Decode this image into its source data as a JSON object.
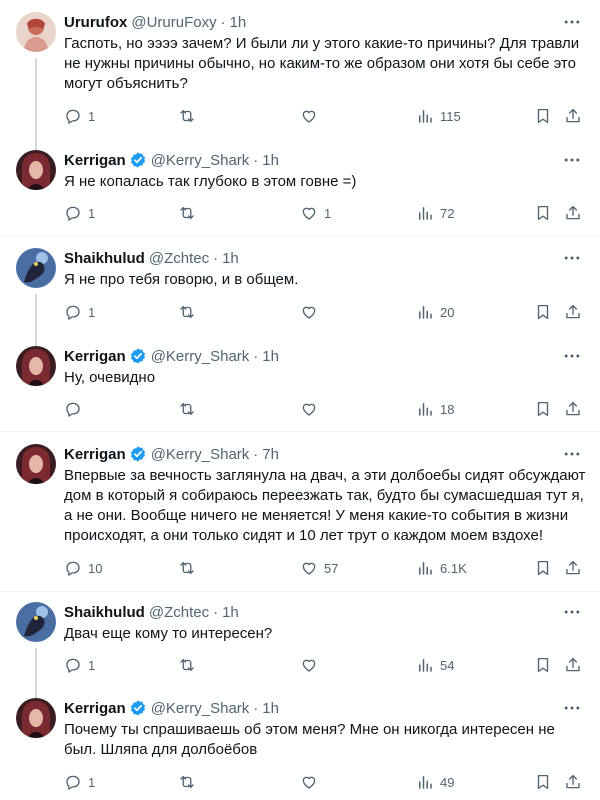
{
  "icons": {
    "reply": "reply-icon",
    "retweet": "retweet-icon",
    "like": "heart-icon",
    "views": "views-chart-icon",
    "bookmark": "bookmark-icon",
    "share": "share-icon",
    "more": "more-dots-icon",
    "verified": "verified-badge-icon"
  },
  "colors": {
    "accent": "#1d9bf0",
    "text": "#0f1419",
    "muted": "#536471",
    "line": "#cfd9de"
  },
  "tweets": [
    {
      "name": "Ururufox",
      "handle": "@UruruFoxy",
      "dot": "·",
      "time": "1h",
      "text": "Гаспоть, но ээээ зачем? И были ли у этого какие-то причины? Для травли не нужны причины обычно, но каким-то же образом они хотя бы себе это могут объяснить?",
      "replies": "1",
      "retweets": "",
      "likes": "",
      "views": "115"
    },
    {
      "name": "Kerrigan",
      "handle": "@Kerry_Shark",
      "dot": "·",
      "time": "1h",
      "text": "Я не копалась так глубоко в этом говне =)",
      "replies": "1",
      "retweets": "",
      "likes": "1",
      "views": "72"
    },
    {
      "name": "Shaikhulud",
      "handle": "@Zchtec",
      "dot": "·",
      "time": "1h",
      "text": "Я не про тебя говорю, и в общем.",
      "replies": "1",
      "retweets": "",
      "likes": "",
      "views": "20"
    },
    {
      "name": "Kerrigan",
      "handle": "@Kerry_Shark",
      "dot": "·",
      "time": "1h",
      "text": "Ну, очевидно",
      "replies": "",
      "retweets": "",
      "likes": "",
      "views": "18"
    },
    {
      "name": "Kerrigan",
      "handle": "@Kerry_Shark",
      "dot": "·",
      "time": "7h",
      "text": "Впервые за вечность заглянула на двач, а эти долбоебы сидят обсуждают дом в который я собираюсь переезжать так, будто бы сумасшедшая тут я, а не они. Вообще ничего не меняется! У меня какие-то события в жизни происходят, а они только сидят и 10 лет трут о каждом моем вздохе!",
      "replies": "10",
      "retweets": "",
      "likes": "57",
      "views": "6.1K"
    },
    {
      "name": "Shaikhulud",
      "handle": "@Zchtec",
      "dot": "·",
      "time": "1h",
      "text": "Двач еще кому то интересен?",
      "replies": "1",
      "retweets": "",
      "likes": "",
      "views": "54"
    },
    {
      "name": "Kerrigan",
      "handle": "@Kerry_Shark",
      "dot": "·",
      "time": "1h",
      "text": "Почему ты спрашиваешь об этом меня? Мне он никогда интересен не был. Шляпа для долбоёбов",
      "replies": "1",
      "retweets": "",
      "likes": "",
      "views": "49"
    }
  ]
}
